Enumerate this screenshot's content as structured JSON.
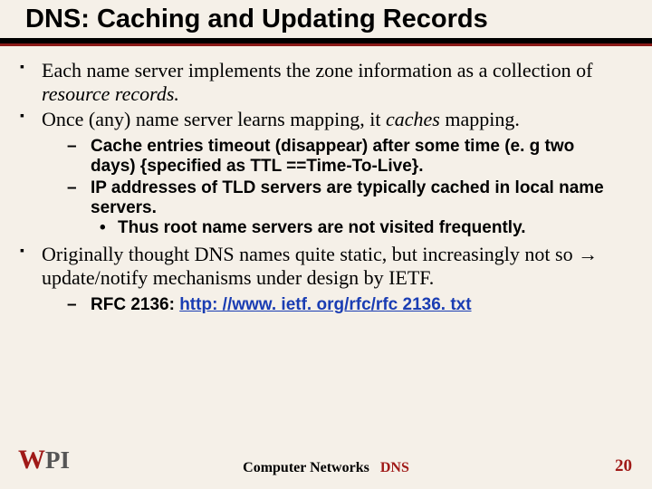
{
  "title": "DNS: Caching and Updating Records",
  "bullets": {
    "b1_a": "Each name server implements the zone information as a collection of ",
    "b1_em": "resource records.",
    "b2_a": "Once (any) name server learns mapping, it ",
    "b2_em": "caches",
    "b2_b": " mapping.",
    "s1_a": "Cache entries timeout (disappear) after some time (e. g two days) ",
    "s1_brace": "{specified as TTL ==Time-To-Live}",
    "s1_dot": ".",
    "s2": "IP addresses of TLD servers are typically cached in local name servers.",
    "s2_sub": "Thus root name servers are not visited frequently.",
    "b3_a": "Originally thought DNS names quite static, but increasingly not so ",
    "b3_arrow": "→",
    "b3_b": " update/notify mechanisms under design by IETF.",
    "s3_a": "RFC 2136: ",
    "s3_link": "http: //www. ietf. org/rfc/rfc 2136. txt"
  },
  "footer": {
    "center_left": "Computer Networks",
    "center_right": "DNS",
    "page": "20"
  },
  "logo": {
    "text_w": "W",
    "text_pi": "PI"
  }
}
